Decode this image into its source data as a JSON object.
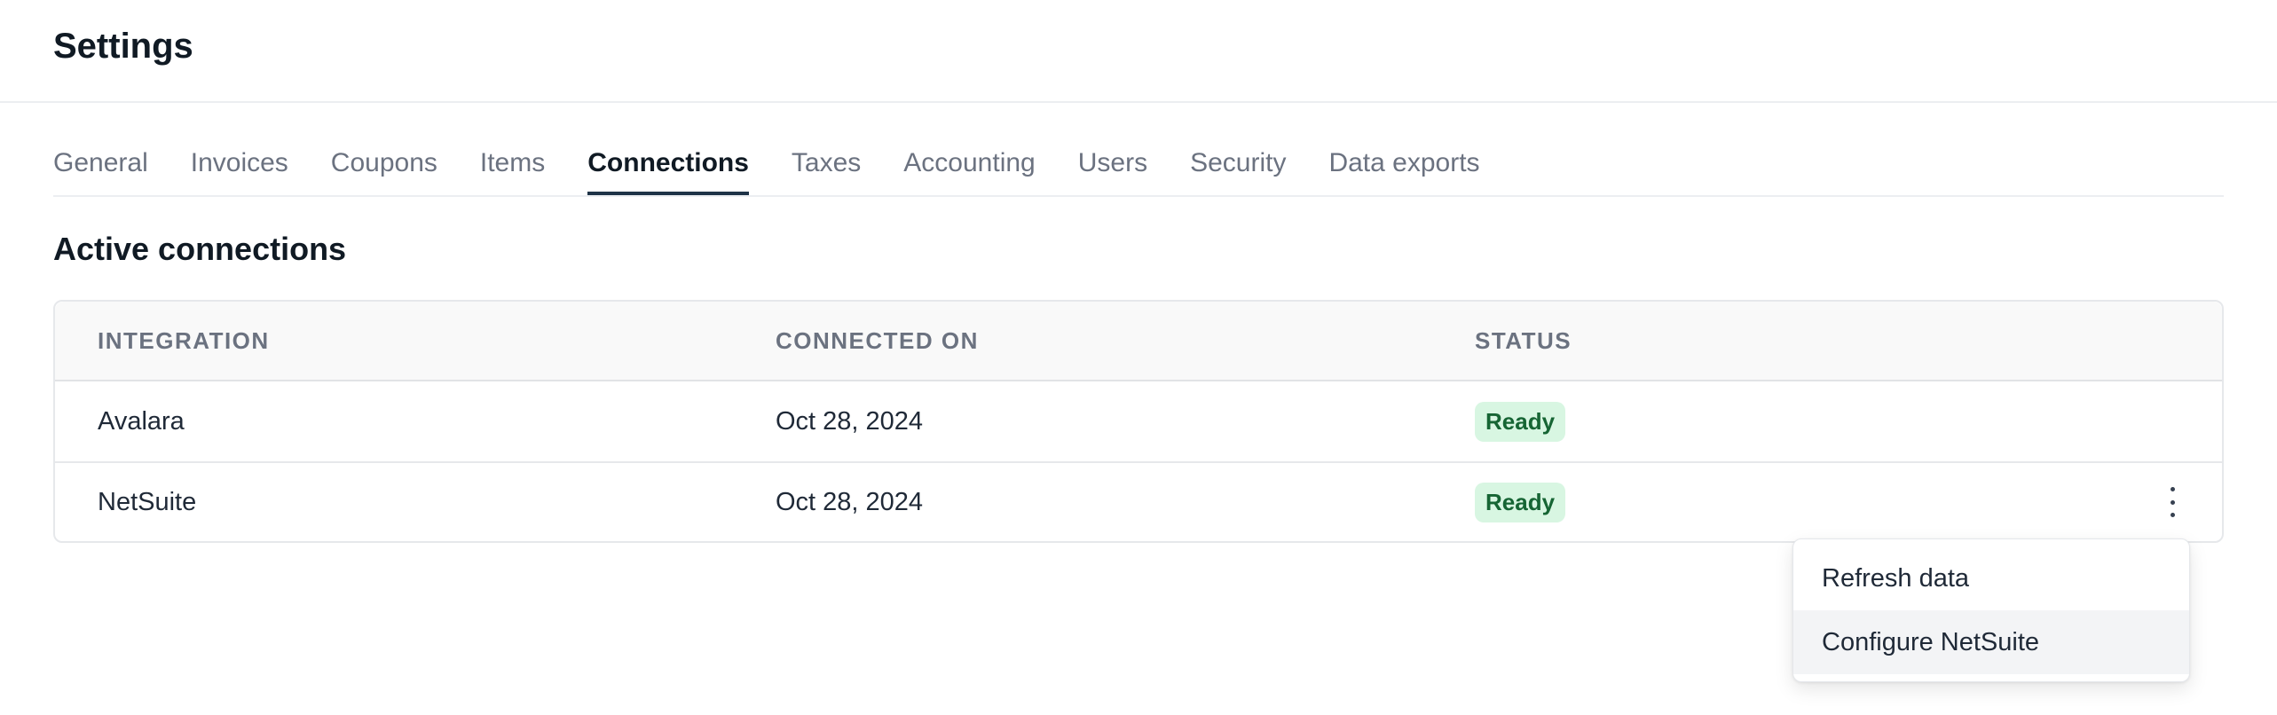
{
  "header": {
    "title": "Settings"
  },
  "tabs": [
    {
      "label": "General"
    },
    {
      "label": "Invoices"
    },
    {
      "label": "Coupons"
    },
    {
      "label": "Items"
    },
    {
      "label": "Connections",
      "active": true
    },
    {
      "label": "Taxes"
    },
    {
      "label": "Accounting"
    },
    {
      "label": "Users"
    },
    {
      "label": "Security"
    },
    {
      "label": "Data exports"
    }
  ],
  "section": {
    "title": "Active connections"
  },
  "table": {
    "columns": [
      "INTEGRATION",
      "CONNECTED ON",
      "STATUS"
    ],
    "rows": [
      {
        "integration": "Avalara",
        "connected_on": "Oct 28, 2024",
        "status": "Ready"
      },
      {
        "integration": "NetSuite",
        "connected_on": "Oct 28, 2024",
        "status": "Ready"
      }
    ]
  },
  "row_actions_icon": "more-vertical-icon",
  "menu": {
    "items": [
      {
        "label": "Refresh data"
      },
      {
        "label": "Configure NetSuite",
        "highlighted": true
      }
    ]
  },
  "colors": {
    "active_tab_underline": "#1f3347",
    "badge_bg": "#d8f6e2",
    "badge_text": "#166534"
  }
}
